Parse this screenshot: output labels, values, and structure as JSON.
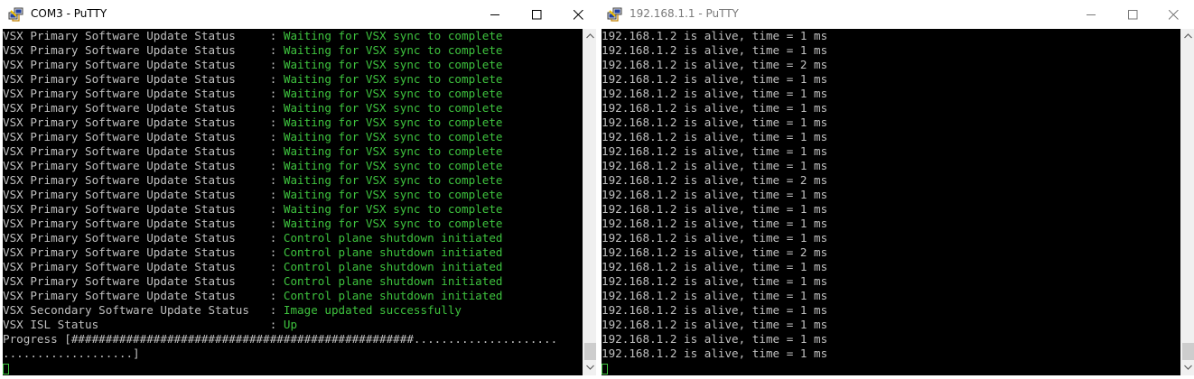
{
  "left_window": {
    "title": "COM3 - PuTTY",
    "icon": "putty-icon",
    "controls": [
      "minimize-icon",
      "maximize-icon",
      "close-icon"
    ],
    "lines": [
      {
        "label": "VSX Primary Software Update Status     ",
        "sep": ": ",
        "value": "Waiting for VSX sync to complete"
      },
      {
        "label": "VSX Primary Software Update Status     ",
        "sep": ": ",
        "value": "Waiting for VSX sync to complete"
      },
      {
        "label": "VSX Primary Software Update Status     ",
        "sep": ": ",
        "value": "Waiting for VSX sync to complete"
      },
      {
        "label": "VSX Primary Software Update Status     ",
        "sep": ": ",
        "value": "Waiting for VSX sync to complete"
      },
      {
        "label": "VSX Primary Software Update Status     ",
        "sep": ": ",
        "value": "Waiting for VSX sync to complete"
      },
      {
        "label": "VSX Primary Software Update Status     ",
        "sep": ": ",
        "value": "Waiting for VSX sync to complete"
      },
      {
        "label": "VSX Primary Software Update Status     ",
        "sep": ": ",
        "value": "Waiting for VSX sync to complete"
      },
      {
        "label": "VSX Primary Software Update Status     ",
        "sep": ": ",
        "value": "Waiting for VSX sync to complete"
      },
      {
        "label": "VSX Primary Software Update Status     ",
        "sep": ": ",
        "value": "Waiting for VSX sync to complete"
      },
      {
        "label": "VSX Primary Software Update Status     ",
        "sep": ": ",
        "value": "Waiting for VSX sync to complete"
      },
      {
        "label": "VSX Primary Software Update Status     ",
        "sep": ": ",
        "value": "Waiting for VSX sync to complete"
      },
      {
        "label": "VSX Primary Software Update Status     ",
        "sep": ": ",
        "value": "Waiting for VSX sync to complete"
      },
      {
        "label": "VSX Primary Software Update Status     ",
        "sep": ": ",
        "value": "Waiting for VSX sync to complete"
      },
      {
        "label": "VSX Primary Software Update Status     ",
        "sep": ": ",
        "value": "Waiting for VSX sync to complete"
      },
      {
        "label": "VSX Primary Software Update Status     ",
        "sep": ": ",
        "value": "Control plane shutdown initiated"
      },
      {
        "label": "VSX Primary Software Update Status     ",
        "sep": ": ",
        "value": "Control plane shutdown initiated"
      },
      {
        "label": "VSX Primary Software Update Status     ",
        "sep": ": ",
        "value": "Control plane shutdown initiated"
      },
      {
        "label": "VSX Primary Software Update Status     ",
        "sep": ": ",
        "value": "Control plane shutdown initiated"
      },
      {
        "label": "VSX Primary Software Update Status     ",
        "sep": ": ",
        "value": "Control plane shutdown initiated"
      },
      {
        "label": "VSX Secondary Software Update Status   ",
        "sep": ": ",
        "value": "Image updated successfully"
      },
      {
        "label": "VSX ISL Status                         ",
        "sep": ": ",
        "value": "Up"
      }
    ],
    "progress_line_1": "Progress [##################################################.....................",
    "progress_line_2": "...................]"
  },
  "right_window": {
    "title": "192.168.1.1 - PuTTY",
    "icon": "putty-icon",
    "controls": [
      "minimize-icon",
      "maximize-icon",
      "close-icon"
    ],
    "lines": [
      "192.168.1.2 is alive, time = 1 ms",
      "192.168.1.2 is alive, time = 1 ms",
      "192.168.1.2 is alive, time = 2 ms",
      "192.168.1.2 is alive, time = 1 ms",
      "192.168.1.2 is alive, time = 1 ms",
      "192.168.1.2 is alive, time = 1 ms",
      "192.168.1.2 is alive, time = 1 ms",
      "192.168.1.2 is alive, time = 1 ms",
      "192.168.1.2 is alive, time = 1 ms",
      "192.168.1.2 is alive, time = 1 ms",
      "192.168.1.2 is alive, time = 2 ms",
      "192.168.1.2 is alive, time = 1 ms",
      "192.168.1.2 is alive, time = 1 ms",
      "192.168.1.2 is alive, time = 1 ms",
      "192.168.1.2 is alive, time = 1 ms",
      "192.168.1.2 is alive, time = 2 ms",
      "192.168.1.2 is alive, time = 1 ms",
      "192.168.1.2 is alive, time = 1 ms",
      "192.168.1.2 is alive, time = 1 ms",
      "192.168.1.2 is alive, time = 1 ms",
      "192.168.1.2 is alive, time = 1 ms",
      "192.168.1.2 is alive, time = 1 ms",
      "192.168.1.2 is alive, time = 1 ms"
    ]
  },
  "colors": {
    "terminal_bg": "#000000",
    "terminal_text": "#c0c0c0",
    "terminal_green": "#3ec33e",
    "titlebar_bg": "#ffffff",
    "scrollbar_bg": "#f0f0f0"
  }
}
